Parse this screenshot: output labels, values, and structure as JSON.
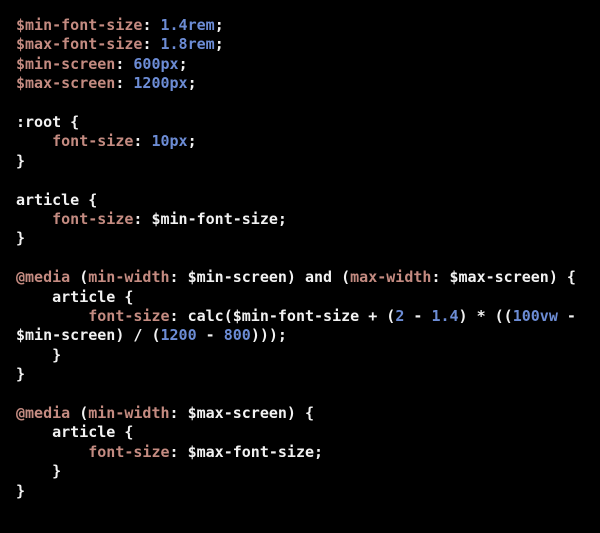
{
  "editor": {
    "language": "scss",
    "background_color": "#000000",
    "default_text_color": "#f2f2f2",
    "property_color": "#c48b81",
    "number_color": "#6c8cd5",
    "font_size_px": 15,
    "line_height_px": 19.4
  },
  "code": {
    "lines": [
      {
        "id": "line-1",
        "tokens": [
          {
            "t": "$min-font-size",
            "c": "prop"
          },
          {
            "t": ": ",
            "c": "plain"
          },
          {
            "t": "1.4rem",
            "c": "num"
          },
          {
            "t": ";",
            "c": "plain"
          }
        ]
      },
      {
        "id": "line-2",
        "tokens": [
          {
            "t": "$max-font-size",
            "c": "prop"
          },
          {
            "t": ": ",
            "c": "plain"
          },
          {
            "t": "1.8rem",
            "c": "num"
          },
          {
            "t": ";",
            "c": "plain"
          }
        ]
      },
      {
        "id": "line-3",
        "tokens": [
          {
            "t": "$min-screen",
            "c": "prop"
          },
          {
            "t": ": ",
            "c": "plain"
          },
          {
            "t": "600px",
            "c": "num"
          },
          {
            "t": ";",
            "c": "plain"
          }
        ]
      },
      {
        "id": "line-4",
        "tokens": [
          {
            "t": "$max-screen",
            "c": "prop"
          },
          {
            "t": ": ",
            "c": "plain"
          },
          {
            "t": "1200px",
            "c": "num"
          },
          {
            "t": ";",
            "c": "plain"
          }
        ]
      },
      {
        "id": "line-5",
        "blank": true,
        "tokens": []
      },
      {
        "id": "line-6",
        "tokens": [
          {
            "t": ":root {",
            "c": "plain"
          }
        ]
      },
      {
        "id": "line-7",
        "tokens": [
          {
            "t": "    ",
            "c": "plain"
          },
          {
            "t": "font-size",
            "c": "prop"
          },
          {
            "t": ": ",
            "c": "plain"
          },
          {
            "t": "10px",
            "c": "num"
          },
          {
            "t": ";",
            "c": "plain"
          }
        ]
      },
      {
        "id": "line-8",
        "tokens": [
          {
            "t": "}",
            "c": "plain"
          }
        ]
      },
      {
        "id": "line-9",
        "blank": true,
        "tokens": []
      },
      {
        "id": "line-10",
        "tokens": [
          {
            "t": "article {",
            "c": "plain"
          }
        ]
      },
      {
        "id": "line-11",
        "tokens": [
          {
            "t": "    ",
            "c": "plain"
          },
          {
            "t": "font-size",
            "c": "prop"
          },
          {
            "t": ": $min-font-size;",
            "c": "plain"
          }
        ]
      },
      {
        "id": "line-12",
        "tokens": [
          {
            "t": "}",
            "c": "plain"
          }
        ]
      },
      {
        "id": "line-13",
        "blank": true,
        "tokens": []
      },
      {
        "id": "line-14",
        "tokens": [
          {
            "t": "@media",
            "c": "at"
          },
          {
            "t": " (",
            "c": "plain"
          },
          {
            "t": "min-width",
            "c": "prop"
          },
          {
            "t": ": $min-screen) and (",
            "c": "plain"
          },
          {
            "t": "max-width",
            "c": "prop"
          },
          {
            "t": ": $max-screen) {",
            "c": "plain"
          }
        ]
      },
      {
        "id": "line-15",
        "tokens": [
          {
            "t": "    article {",
            "c": "plain"
          }
        ]
      },
      {
        "id": "line-16",
        "tokens": [
          {
            "t": "        ",
            "c": "plain"
          },
          {
            "t": "font-size",
            "c": "prop"
          },
          {
            "t": ": calc($min-font-size + (",
            "c": "plain"
          },
          {
            "t": "2",
            "c": "num"
          },
          {
            "t": " - ",
            "c": "plain"
          },
          {
            "t": "1.4",
            "c": "num"
          },
          {
            "t": ") * ((",
            "c": "plain"
          },
          {
            "t": "100vw",
            "c": "num"
          },
          {
            "t": " - $min-screen) / (",
            "c": "plain"
          },
          {
            "t": "1200",
            "c": "num"
          },
          {
            "t": " - ",
            "c": "plain"
          },
          {
            "t": "800",
            "c": "num"
          },
          {
            "t": ")));",
            "c": "plain"
          }
        ]
      },
      {
        "id": "line-17",
        "tokens": [
          {
            "t": "    }",
            "c": "plain"
          }
        ]
      },
      {
        "id": "line-18",
        "tokens": [
          {
            "t": "}",
            "c": "plain"
          }
        ]
      },
      {
        "id": "line-19",
        "blank": true,
        "tokens": []
      },
      {
        "id": "line-20",
        "tokens": [
          {
            "t": "@media",
            "c": "at"
          },
          {
            "t": " (",
            "c": "plain"
          },
          {
            "t": "min-width",
            "c": "prop"
          },
          {
            "t": ": $max-screen) {",
            "c": "plain"
          }
        ]
      },
      {
        "id": "line-21",
        "tokens": [
          {
            "t": "    article {",
            "c": "plain"
          }
        ]
      },
      {
        "id": "line-22",
        "tokens": [
          {
            "t": "        ",
            "c": "plain"
          },
          {
            "t": "font-size",
            "c": "prop"
          },
          {
            "t": ": $max-font-size;",
            "c": "plain"
          }
        ]
      },
      {
        "id": "line-23",
        "tokens": [
          {
            "t": "    }",
            "c": "plain"
          }
        ]
      },
      {
        "id": "line-24",
        "tokens": [
          {
            "t": "}",
            "c": "plain"
          }
        ]
      }
    ]
  }
}
